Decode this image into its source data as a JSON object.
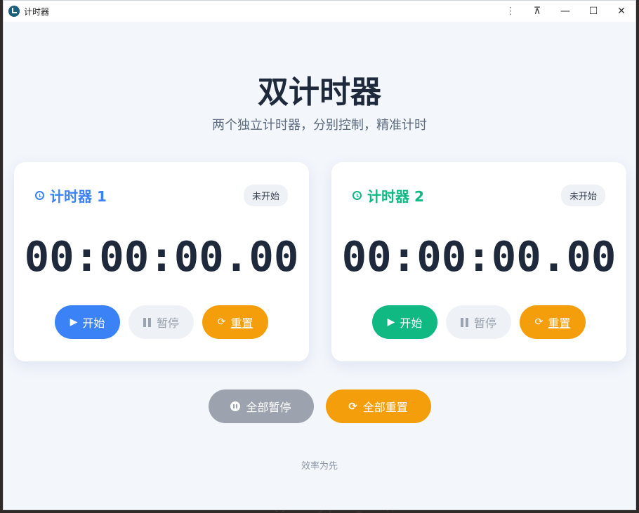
{
  "window": {
    "title": "计时器"
  },
  "hero": {
    "title": "双计时器",
    "subtitle": "两个独立计时器，分别控制，精准计时"
  },
  "timers": [
    {
      "name": "计时器 1",
      "status": "未开始",
      "time": "00:00:00.00",
      "start_label": "开始",
      "pause_label": "暂停",
      "reset_label": "重置",
      "accent": "#3b82f6"
    },
    {
      "name": "计时器 2",
      "status": "未开始",
      "time": "00:00:00.00",
      "start_label": "开始",
      "pause_label": "暂停",
      "reset_label": "重置",
      "accent": "#10b981"
    }
  ],
  "global": {
    "pause_all_label": "全部暂停",
    "reset_all_label": "全部重置"
  },
  "footer": {
    "text": "效率为先"
  },
  "colors": {
    "reset": "#f59e0b",
    "pause_all": "#9ca3af",
    "background": "#f3f6fb"
  },
  "icons": [
    "clock-icon",
    "play-icon",
    "pause-icon",
    "refresh-icon",
    "pause-circle-icon"
  ]
}
